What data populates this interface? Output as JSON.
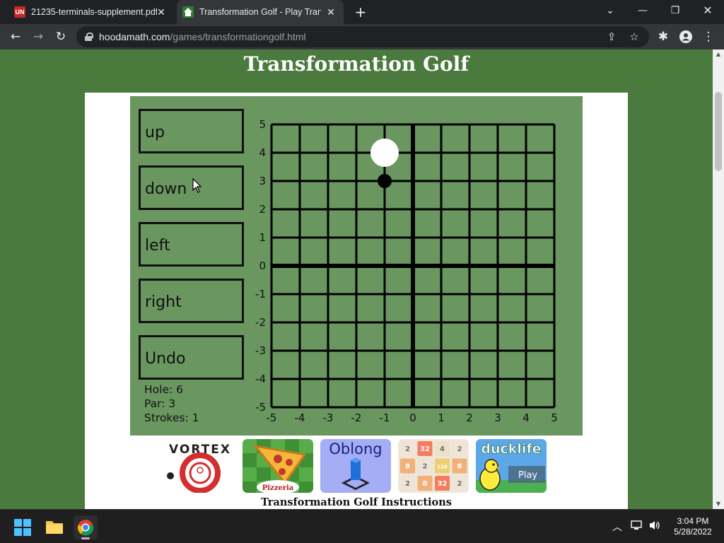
{
  "browser": {
    "tabs": [
      {
        "title": "21235-terminals-supplement.pdf",
        "favicon": "UN"
      },
      {
        "title": "Transformation Golf - Play Transf",
        "favicon": "house"
      }
    ],
    "url_host": "hoodamath.com",
    "url_path": "/games/transformationgolf.html"
  },
  "page": {
    "title": "Transformation Golf",
    "instructions_heading": "Transformation Golf Instructions"
  },
  "game": {
    "buttons": [
      "up",
      "down",
      "left",
      "right",
      "Undo"
    ],
    "hole": "Hole: 6",
    "par": "Par: 3",
    "strokes": "Strokes: 1",
    "x_ticks": [
      "-5",
      "-4",
      "-3",
      "-2",
      "-1",
      "0",
      "1",
      "2",
      "3",
      "4",
      "5"
    ],
    "y_ticks": [
      "5",
      "4",
      "3",
      "2",
      "1",
      "0",
      "-1",
      "-2",
      "-3",
      "-4",
      "-5"
    ],
    "hole_position": {
      "x": -1,
      "y": 4
    },
    "ball_position": {
      "x": -1,
      "y": 3
    },
    "colors": {
      "board_bg": "#6a9660",
      "page_bg": "#4a7a3e"
    }
  },
  "related_games": [
    {
      "name": "vortex",
      "label": "VORTEX"
    },
    {
      "name": "papas-pizzeria",
      "label": "Papa's Pizzeria"
    },
    {
      "name": "oblong",
      "label": "Oblong"
    },
    {
      "name": "2048",
      "tiles": [
        "2",
        "32",
        "4",
        "2",
        "8",
        "2",
        "128",
        "8",
        "2",
        "8",
        "32",
        "2"
      ]
    },
    {
      "name": "ducklife",
      "label": "ducklife",
      "play": "Play"
    }
  ],
  "taskbar": {
    "time": "3:04 PM",
    "date": "5/28/2022"
  }
}
